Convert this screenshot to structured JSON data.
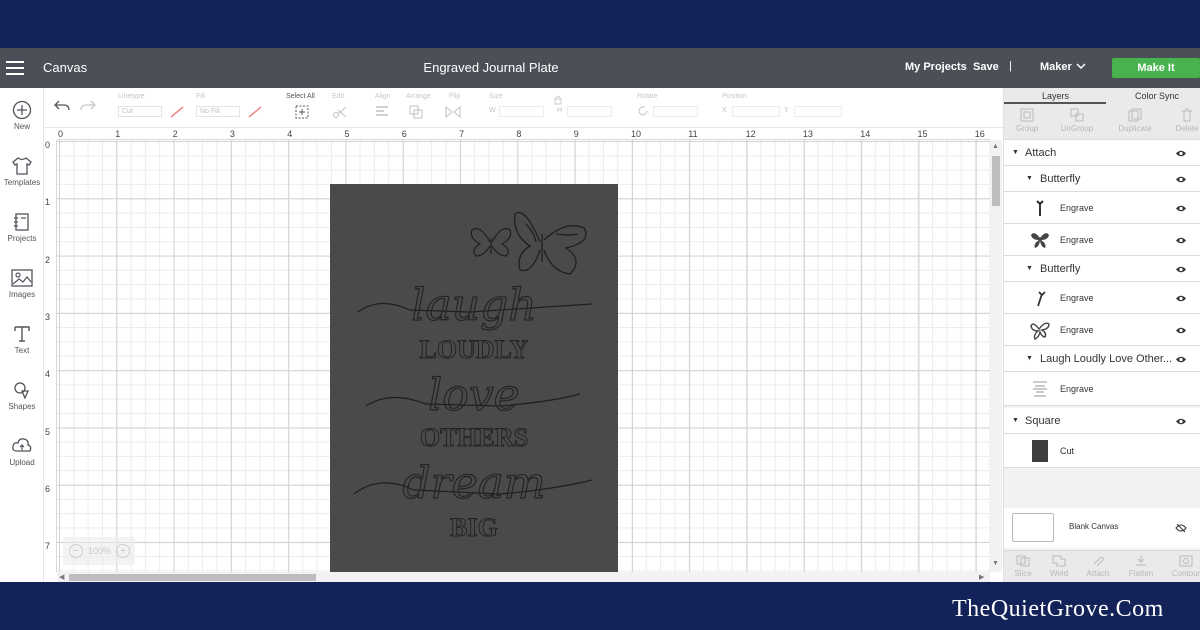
{
  "header": {
    "section_label": "Canvas",
    "project_title": "Engraved Journal Plate",
    "my_projects": "My Projects",
    "save": "Save",
    "separator": "|",
    "machine": "Maker",
    "make_it": "Make It"
  },
  "sidebar": {
    "items": [
      {
        "label": "New",
        "icon": "plus-circle-icon"
      },
      {
        "label": "Templates",
        "icon": "shirt-icon"
      },
      {
        "label": "Projects",
        "icon": "notebook-icon"
      },
      {
        "label": "Images",
        "icon": "image-icon"
      },
      {
        "label": "Text",
        "icon": "text-t-icon"
      },
      {
        "label": "Shapes",
        "icon": "shapes-icon"
      },
      {
        "label": "Upload",
        "icon": "cloud-upload-icon"
      }
    ]
  },
  "toolbar": {
    "linetype_label": "Linetype",
    "linetype_value": "Cut",
    "fill_label": "Fill",
    "fill_value": "No Fill",
    "select_all": "Select All",
    "edit": "Edit",
    "align": "Align",
    "arrange": "Arrange",
    "flip": "Flip",
    "size": "Size",
    "size_w": "W",
    "size_h": "H",
    "rotate": "Rotate",
    "position": "Position",
    "pos_x": "X",
    "pos_y": "Y"
  },
  "rulers": {
    "top": [
      "0",
      "1",
      "2",
      "3",
      "4",
      "5",
      "6",
      "7",
      "8",
      "9",
      "10",
      "11",
      "12",
      "13",
      "14",
      "15",
      "16"
    ],
    "left": [
      "0",
      "1",
      "2",
      "3",
      "4",
      "5",
      "6",
      "7"
    ]
  },
  "zoom": {
    "value": "100%",
    "minus": "−",
    "plus": "+"
  },
  "plate_art": {
    "words": [
      "laugh",
      "LOUDLY",
      "love",
      "OTHERS",
      "dream",
      "BIG"
    ],
    "color": "#4a4a4a"
  },
  "panel": {
    "tabs": [
      "Layers",
      "Color Sync"
    ],
    "actions": [
      "Group",
      "UnGroup",
      "Duplicate",
      "Delete"
    ],
    "layers": {
      "attach": "Attach",
      "butterfly1": "Butterfly",
      "b1_engrave1": "Engrave",
      "b1_engrave2": "Engrave",
      "butterfly2": "Butterfly",
      "b2_engrave1": "Engrave",
      "b2_engrave2": "Engrave",
      "text_group": "Laugh Loudly Love Other...",
      "text_engrave": "Engrave",
      "square": "Square",
      "square_cut": "Cut"
    },
    "blank_canvas": "Blank Canvas",
    "bottom_actions": [
      "Slice",
      "Weld",
      "Attach",
      "Flatten",
      "Contour"
    ]
  },
  "watermark": "TheQuietGrove.Com",
  "colors": {
    "make_it": "#48b24e",
    "topbar": "#4b5058",
    "frame": "#13235a"
  }
}
